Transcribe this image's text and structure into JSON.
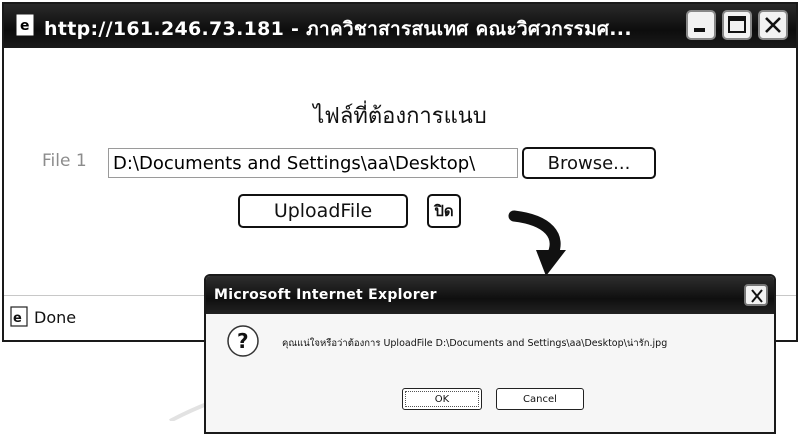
{
  "window": {
    "title": "http://161.246.73.181 - ภาควิชาสารสนเทศ คณะวิศวกรรมศ...",
    "icon": "ie-page-icon"
  },
  "page": {
    "heading": "ไฟล์ที่ต้องการแนบ",
    "file_label": "File 1",
    "file_value": "D:\\Documents and Settings\\aa\\Desktop\\",
    "browse_label": "Browse...",
    "upload_label": "UploadFile",
    "close_label": "ปิด"
  },
  "status": {
    "text": "Done",
    "icon": "ie-icon"
  },
  "dialog": {
    "title": "Microsoft Internet Explorer",
    "icon": "question-icon",
    "message": "คุณแน่ใจหรือว่าต้องการ UploadFile D:\\Documents and Settings\\aa\\Desktop\\น่ารัก.jpg",
    "ok_label": "OK",
    "cancel_label": "Cancel"
  }
}
